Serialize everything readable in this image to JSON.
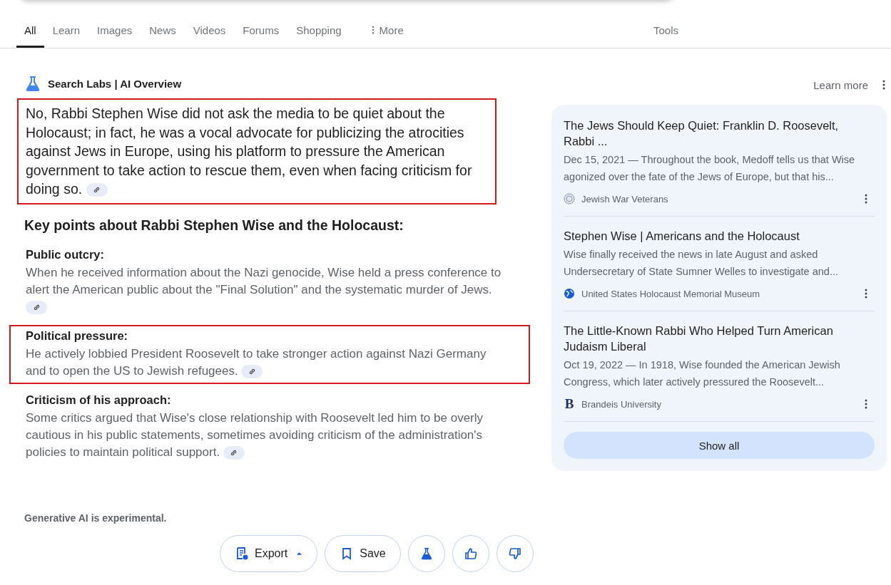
{
  "tabs": [
    {
      "label": "All",
      "selected": true
    },
    {
      "label": "Learn",
      "selected": false
    },
    {
      "label": "Images",
      "selected": false
    },
    {
      "label": "News",
      "selected": false
    },
    {
      "label": "Videos",
      "selected": false
    },
    {
      "label": "Forums",
      "selected": false
    },
    {
      "label": "Shopping",
      "selected": false
    },
    {
      "label": "More",
      "selected": false,
      "kind": "menu"
    }
  ],
  "tools": "Tools",
  "overview": {
    "title": "Search Labs | AI Overview",
    "learn_more": "Learn more",
    "answer": {
      "text": "No, Rabbi Stephen Wise did not ask the media to be quiet about the Holocaust; in fact, he was a vocal advocate for publicizing the atrocities against Jews in Europe, using his platform to pressure the American government to take action to rescue them, even when facing criticism for doing so.",
      "highlighted": true
    },
    "heading": "Key points about Rabbi Stephen Wise and the Holocaust:",
    "points": [
      {
        "title": "Public outcry:",
        "text": "When he received information about the Nazi genocide, Wise held a press conference to alert the American public about the \"Final Solution\" and the systematic murder of Jews.",
        "highlighted": false
      },
      {
        "title": "Political pressure:",
        "text": "He actively lobbied President Roosevelt to take stronger action against Nazi Germany and to open the US to Jewish refugees.",
        "highlighted": true
      },
      {
        "title": "Criticism of his approach:",
        "text": "Some critics argued that Wise's close relationship with Roosevelt led him to be overly cautious in his public statements, sometimes avoiding criticism of the administration's policies to maintain political support.",
        "highlighted": false
      }
    ],
    "disclaimer": "Generative AI is experimental.",
    "actions": [
      {
        "kind": "export",
        "label": "Export"
      },
      {
        "kind": "save",
        "label": "Save"
      },
      {
        "kind": "labs"
      },
      {
        "kind": "like"
      },
      {
        "kind": "dislike"
      }
    ]
  },
  "sources": {
    "items": [
      {
        "title": "The Jews Should Keep Quiet: Franklin D. Roosevelt, Rabbi ...",
        "snippet": "Dec 15, 2021 — Throughout the book, Medoff tells us that Wise agonized over the fate of the Jews of Europe, but that his...",
        "site": "Jewish War Veterans",
        "kind": "seal"
      },
      {
        "title": "Stephen Wise | Americans and the Holocaust",
        "snippet": "Wise finally received the news in late August and asked Undersecretary of State Sumner Welles to investigate and...",
        "site": "United States Holocaust Memorial Museum",
        "kind": "globe"
      },
      {
        "title": "The Little-Known Rabbi Who Helped Turn American Judaism Liberal",
        "snippet": "Oct 19, 2022 — In 1918, Wise founded the American Jewish Congress, which later actively pressured the Roosevelt...",
        "site": "Brandeis University",
        "kind": "letter",
        "icon_letter": "B"
      }
    ],
    "show_all": "Show all"
  }
}
